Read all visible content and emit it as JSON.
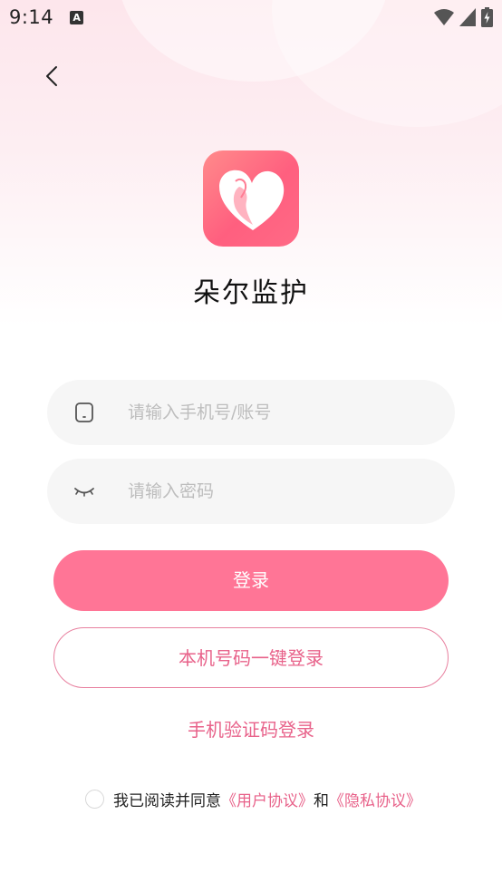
{
  "status_bar": {
    "time": "9:14",
    "notification_letter": "A"
  },
  "app": {
    "name": "朵尔监护"
  },
  "form": {
    "account_placeholder": "请输入手机号/账号",
    "password_placeholder": "请输入密码",
    "login_label": "登录",
    "one_key_login_label": "本机号码一键登录",
    "sms_login_label": "手机验证码登录"
  },
  "agreement": {
    "prefix": "我已阅读并同意",
    "user_agreement": "《用户协议》",
    "conjunction": "和",
    "privacy_agreement": "《隐私协议》"
  },
  "colors": {
    "accent": "#ff7596",
    "link": "#e8628a"
  }
}
